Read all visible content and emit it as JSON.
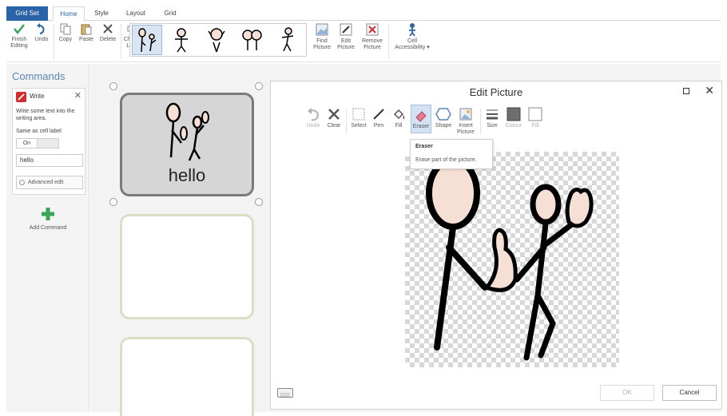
{
  "tabs": {
    "grid_set": "Grid Set",
    "home": "Home",
    "style": "Style",
    "layout": "Layout",
    "grid": "Grid"
  },
  "ribbon": {
    "finish_editing": "Finish Editing",
    "undo": "Undo",
    "copy": "Copy",
    "paste": "Paste",
    "delete": "Delete",
    "change_label": "Change Label",
    "find_picture": "Find Picture",
    "edit_picture": "Edit Picture",
    "remove_picture": "Remove Picture",
    "cell_accessibility": "Cell Accessibility ▾"
  },
  "commands": {
    "title": "Commands",
    "command_name": "Write",
    "description": "Write some text into the writing area.",
    "same_as_label": "Same as cell label",
    "toggle_on": "On",
    "text_value": "hello",
    "advanced_edit": "Advanced edit",
    "add_command": "Add Command"
  },
  "cells": {
    "active_label": "hello"
  },
  "dialog": {
    "title": "Edit Picture",
    "tools": {
      "undo": "Undo",
      "clear": "Clear",
      "select": "Select",
      "pen": "Pen",
      "fill": "Fill",
      "eraser": "Eraser",
      "shape": "Shape",
      "insert_picture": "Insert Picture",
      "size": "Size",
      "colour": "Colour",
      "fill2": "Fill"
    },
    "tooltip_title": "Eraser",
    "tooltip_desc": "Erase part of the picture.",
    "ok": "OK",
    "cancel": "Cancel"
  },
  "colors": {
    "accent": "#2b63a8",
    "write_icon": "#d22d2d",
    "add_icon": "#3aa55a",
    "check": "#3aa55a"
  },
  "icons": [
    "check-icon",
    "undo-icon",
    "copy-icon",
    "paste-icon",
    "delete-icon",
    "change-label-icon",
    "find-picture-icon",
    "edit-picture-icon",
    "remove-picture-icon",
    "cell-accessibility-icon",
    "write-icon",
    "add-command-icon",
    "keyboard-icon"
  ]
}
